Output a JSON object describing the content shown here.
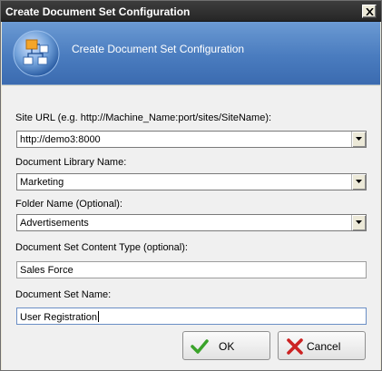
{
  "window": {
    "title": "Create Document Set Configuration"
  },
  "header": {
    "title": "Create Document Set Configuration",
    "icon": "document-structure-icon"
  },
  "form": {
    "site_url": {
      "label": "Site URL (e.g. http://Machine_Name:port/sites/SiteName):",
      "value": "http://demo3:8000"
    },
    "document_library": {
      "label": "Document Library Name:",
      "value": "Marketing"
    },
    "folder_name": {
      "label": "Folder Name (Optional):",
      "value": "Advertisements"
    },
    "content_type": {
      "label": "Document Set Content Type (optional):",
      "value": "Sales Force"
    },
    "document_set_name": {
      "label": "Document Set Name:",
      "value": "User Registration"
    }
  },
  "buttons": {
    "ok_label": "OK",
    "cancel_label": "Cancel",
    "ok_icon": "checkmark-icon",
    "cancel_icon": "x-mark-icon"
  },
  "colors": {
    "titlebar": "#2f2f2f",
    "banner": "#4a7cbf",
    "ok_green": "#3aa32a",
    "cancel_red": "#cc2222"
  }
}
